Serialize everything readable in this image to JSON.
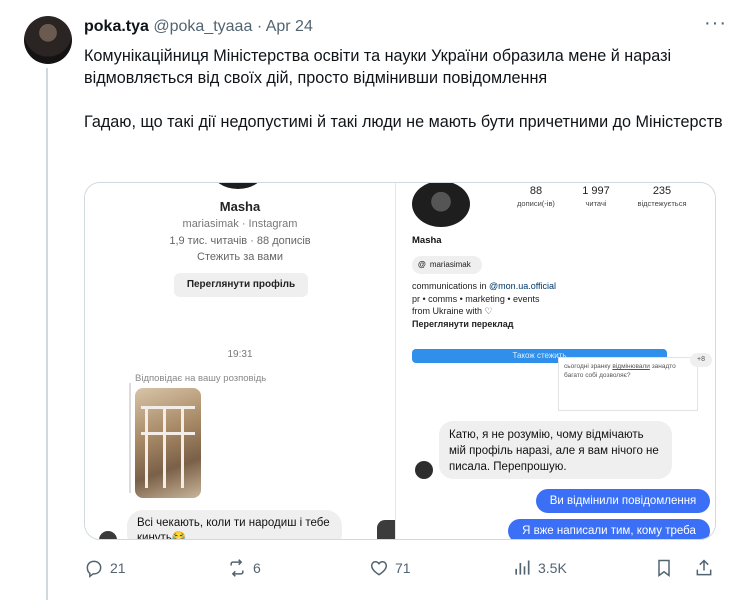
{
  "tweet": {
    "display_name": "poka.tya",
    "handle": "@poka_tyaaa",
    "separator": "·",
    "date": "Apr 24",
    "more_label": "···",
    "paragraphs": [
      "Комунікаційниця Міністерства освіти та науки України образила мене й наразі відмовляється від своїх дій, просто відмінивши повідомлення",
      "Гадаю, що такі дії недопустимі й такі люди не мають бути причетними до Міністерств"
    ]
  },
  "media": {
    "left": {
      "name": "Masha",
      "handle_line": "mariasimak · Instagram",
      "stats_line": "1,9 тис. читачів · 88 дописів",
      "follows_line": "Стежить за вами",
      "view_profile_button": "Переглянути профіль",
      "time": "19:31",
      "reply_label": "Відповідає на вашу розповідь",
      "message": "Всі чекають, коли ти народиш і тебе кинуть😂"
    },
    "right": {
      "stats": [
        {
          "num": "88",
          "label": "дописи(-ів)"
        },
        {
          "num": "1 997",
          "label": "читачі"
        },
        {
          "num": "235",
          "label": "відстежується"
        }
      ],
      "name": "Masha",
      "threads_handle": "mariasimak",
      "threads_at": "@",
      "bio_prefix": "communications in ",
      "bio_link": "@mon.ua.official",
      "bio_line2": "pr • comms • marketing • events",
      "bio_line3": "from Ukraine with ♡",
      "translate_label": "Переглянути переклад",
      "blue_button_text": "Також стежить",
      "overlay_text_1": "сьогодні зранку",
      "overlay_link": "відмінювали",
      "overlay_text_2": "занадто багато собі дозволяє?",
      "mini_bubble": "+8",
      "message_gray": "Катю, я не розумію, чому відмічають мій профіль наразі, але я вам нічого не писала. Перепрошую.",
      "message_blue_1": "Ви відмінили повідомлення",
      "message_blue_2": "Я вже написали тим, кому треба"
    }
  },
  "actions": {
    "replies": "21",
    "reposts": "6",
    "likes": "71",
    "views": "3.5K"
  },
  "colors": {
    "text_primary": "#0f1419",
    "text_secondary": "#536471",
    "border": "#cfd9de",
    "instagram_blue": "#3b6ff5"
  }
}
